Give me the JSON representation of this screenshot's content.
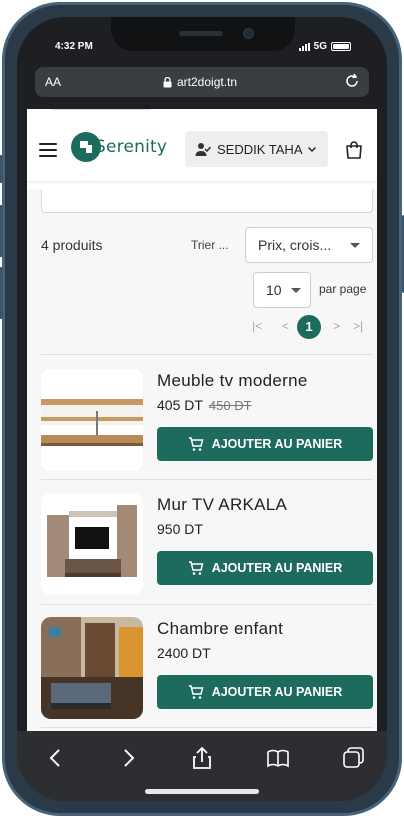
{
  "device": {
    "status_time": "4:32 PM",
    "network": "5G"
  },
  "browser": {
    "aa_label": "AA",
    "url": "art2doigt.tn",
    "toolbar_icons": [
      "back-icon",
      "forward-icon",
      "share-icon",
      "bookmarks-icon",
      "tabs-icon"
    ]
  },
  "header": {
    "logo_text": "Serenity",
    "user_name": "SEDDIK TAHA",
    "icons": [
      "menu-icon",
      "user-check-icon",
      "chevron-down-icon",
      "shopping-bag-icon"
    ]
  },
  "listing": {
    "count_text": "4 produits",
    "sort_label": "Trier ...",
    "sort_value": "Prix, crois...",
    "per_page_value": "10",
    "per_page_label": "par page",
    "pagination": {
      "first": "|<",
      "prev": "<",
      "current": "1",
      "next": ">",
      "last": ">|"
    }
  },
  "products": [
    {
      "name": "Meuble tv moderne",
      "price": "405 DT",
      "old_price": "450 DT",
      "button": "AJOUTER AU PANIER"
    },
    {
      "name": "Mur TV ARKALA",
      "price": "950 DT",
      "old_price": "",
      "button": "AJOUTER AU PANIER"
    },
    {
      "name": "Chambre enfant",
      "price": "2400 DT",
      "old_price": "",
      "button": "AJOUTER AU PANIER"
    }
  ],
  "colors": {
    "brand": "#1c6b5c",
    "frame": "#46637a",
    "toolbar": "#2c2e31"
  }
}
